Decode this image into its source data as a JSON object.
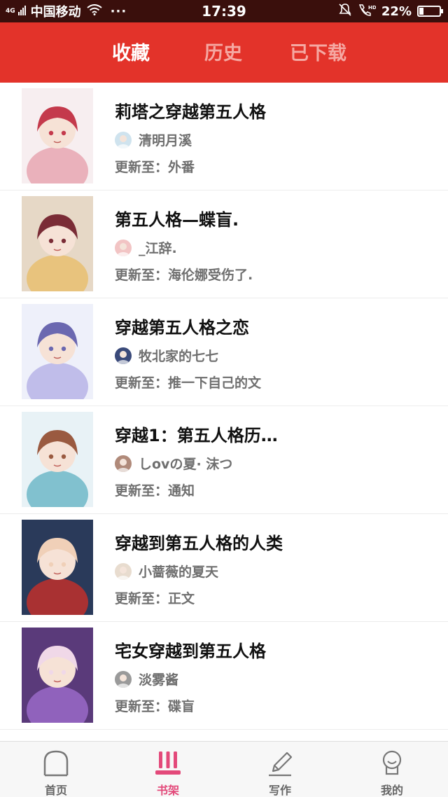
{
  "status_bar": {
    "network": "4G",
    "carrier": "中国移动",
    "more": "···",
    "time": "17:39",
    "battery": "22%",
    "battery_level": 0.22
  },
  "tabs": [
    {
      "label": "收藏",
      "active": true
    },
    {
      "label": "历史",
      "active": false
    },
    {
      "label": "已下载",
      "active": false
    }
  ],
  "books": [
    {
      "title": "莉塔之穿越第五人格",
      "author": "清明月溪",
      "update": "更新至：外番",
      "cover_colors": [
        "#f7eef0",
        "#e8a6b2",
        "#c43a4c"
      ],
      "avatar_color": "#cfe3ee"
    },
    {
      "title": "第五人格—蝶盲.",
      "author": "_江辞.",
      "update": "更新至：海伦娜受伤了.",
      "cover_colors": [
        "#e6d8c6",
        "#e8c070",
        "#7a2c36"
      ],
      "avatar_color": "#f2c4c4"
    },
    {
      "title": "穿越第五人格之恋",
      "author": "牧北家的七七",
      "update": "更新至：推一下自己的文",
      "cover_colors": [
        "#eef0fa",
        "#b7b4e6",
        "#6b68b0"
      ],
      "avatar_color": "#3a4a7a"
    },
    {
      "title": "穿越1：第五人格历…",
      "author": "しovの夏· 沫つ",
      "update": "更新至：通知",
      "cover_colors": [
        "#e8f2f6",
        "#6fb8c8",
        "#9a5a40"
      ],
      "avatar_color": "#b08a7a"
    },
    {
      "title": "穿越到第五人格的人类",
      "author": "小蔷薇的夏天",
      "update": "更新至：正文",
      "cover_colors": [
        "#2a3a5a",
        "#c0302c",
        "#f0d0b8"
      ],
      "avatar_color": "#e8dccf"
    },
    {
      "title": "宅女穿越到第五人格",
      "author": "淡雾酱",
      "update": "更新至：碟盲",
      "cover_colors": [
        "#5a3a7a",
        "#9a6ac8",
        "#f0d8e8"
      ],
      "avatar_color": "#9a9a9a"
    }
  ],
  "bottom_nav": [
    {
      "label": "首页",
      "icon": "home-icon",
      "active": false
    },
    {
      "label": "书架",
      "icon": "bookshelf-icon",
      "active": true
    },
    {
      "label": "写作",
      "icon": "pen-icon",
      "active": false
    },
    {
      "label": "我的",
      "icon": "profile-icon",
      "active": false
    }
  ],
  "colors": {
    "accent": "#e3332a",
    "active_nav": "#e3497a",
    "status_bar": "#3a0f0c"
  }
}
